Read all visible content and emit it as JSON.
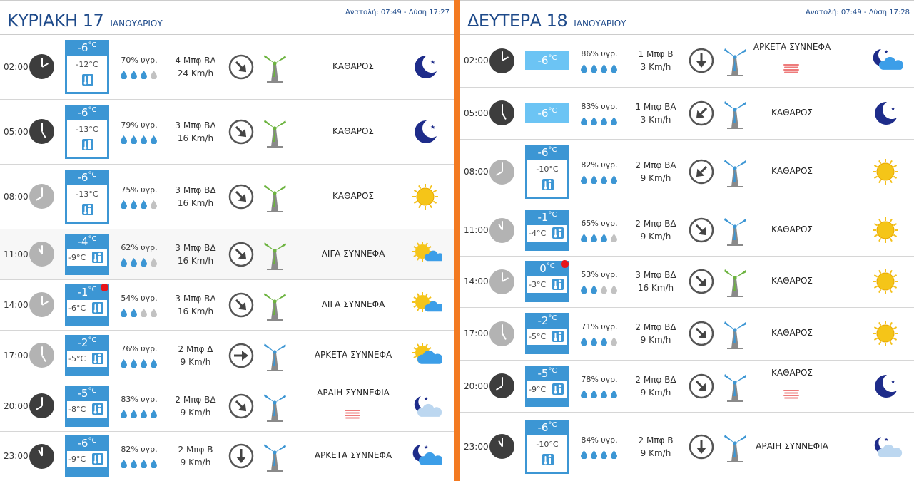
{
  "panels": [
    {
      "day_name": "ΚΥΡΙΑΚΗ 17",
      "month": "ΙΑΝΟΥΑΡΙΟΥ",
      "sun_info": "Ανατολή: 07:49 - Δύση 17:27",
      "rows": [
        {
          "time": "02:00",
          "clock": "night",
          "temp": "-6",
          "feels": "-12°C",
          "box": "full",
          "humidity": "70% υγρ.",
          "drops": [
            1,
            1,
            1,
            0
          ],
          "wind_force": "4 Μπφ ΒΔ",
          "wind_speed": "24 Km/h",
          "arrow": "down-right",
          "turbine": "green",
          "condition": "ΚΑΘΑΡΟΣ",
          "icon": "moon-icon",
          "haze": false,
          "hot": false,
          "shade": false
        },
        {
          "time": "05:00",
          "clock": "night",
          "temp": "-6",
          "feels": "-13°C",
          "box": "full",
          "humidity": "79% υγρ.",
          "drops": [
            1,
            1,
            1,
            1
          ],
          "wind_force": "3 Μπφ ΒΔ",
          "wind_speed": "16 Km/h",
          "arrow": "down-right",
          "turbine": "green",
          "condition": "ΚΑΘΑΡΟΣ",
          "icon": "moon-icon",
          "haze": false,
          "hot": false,
          "shade": false
        },
        {
          "time": "08:00",
          "clock": "day",
          "temp": "-6",
          "feels": "-13°C",
          "box": "full",
          "humidity": "75% υγρ.",
          "drops": [
            1,
            1,
            1,
            0
          ],
          "wind_force": "3 Μπφ ΒΔ",
          "wind_speed": "16 Km/h",
          "arrow": "down-right",
          "turbine": "green",
          "condition": "ΚΑΘΑΡΟΣ",
          "icon": "sun-icon",
          "haze": false,
          "hot": false,
          "shade": false
        },
        {
          "time": "11:00",
          "clock": "day",
          "temp": "-4",
          "feels": "-9°C",
          "box": "half",
          "humidity": "62% υγρ.",
          "drops": [
            1,
            1,
            1,
            0
          ],
          "wind_force": "3 Μπφ ΒΔ",
          "wind_speed": "16 Km/h",
          "arrow": "down-right",
          "turbine": "green",
          "condition": "ΛΙΓΑ ΣΥΝΝΕΦΑ",
          "icon": "sun-small-cloud-icon",
          "haze": false,
          "hot": false,
          "shade": true
        },
        {
          "time": "14:00",
          "clock": "day",
          "temp": "-1",
          "feels": "-6°C",
          "box": "half",
          "humidity": "54% υγρ.",
          "drops": [
            1,
            1,
            0,
            0
          ],
          "wind_force": "3 Μπφ ΒΔ",
          "wind_speed": "16 Km/h",
          "arrow": "down-right",
          "turbine": "green",
          "condition": "ΛΙΓΑ ΣΥΝΝΕΦΑ",
          "icon": "sun-small-cloud-icon",
          "haze": false,
          "hot": true,
          "shade": false
        },
        {
          "time": "17:00",
          "clock": "day",
          "temp": "-2",
          "feels": "-5°C",
          "box": "half",
          "humidity": "76% υγρ.",
          "drops": [
            1,
            1,
            1,
            1
          ],
          "wind_force": "2 Μπφ Δ",
          "wind_speed": "9 Km/h",
          "arrow": "right",
          "turbine": "blue",
          "condition": "ΑΡΚΕΤΑ ΣΥΝΝΕΦΑ",
          "icon": "sun-cloud-icon",
          "haze": false,
          "hot": false,
          "shade": false
        },
        {
          "time": "20:00",
          "clock": "night",
          "temp": "-5",
          "feels": "-8°C",
          "box": "half",
          "humidity": "83% υγρ.",
          "drops": [
            1,
            1,
            1,
            1
          ],
          "wind_force": "2 Μπφ ΒΔ",
          "wind_speed": "9 Km/h",
          "arrow": "down-right",
          "turbine": "blue",
          "condition": "ΑΡΑΙΗ ΣΥΝΝΕΦΙΑ",
          "icon": "moon-haze-icon",
          "haze": true,
          "hot": false,
          "shade": false
        },
        {
          "time": "23:00",
          "clock": "night",
          "temp": "-6",
          "feels": "-9°C",
          "box": "half",
          "humidity": "82% υγρ.",
          "drops": [
            1,
            1,
            1,
            1
          ],
          "wind_force": "2 Μπφ Β",
          "wind_speed": "9 Km/h",
          "arrow": "down",
          "turbine": "blue",
          "condition": "ΑΡΚΕΤΑ ΣΥΝΝΕΦΑ",
          "icon": "moon-cloud-icon",
          "haze": false,
          "hot": false,
          "shade": false
        }
      ]
    },
    {
      "day_name": "ΔΕΥΤΕΡΑ 18",
      "month": "ΙΑΝΟΥΑΡΙΟΥ",
      "sun_info": "Ανατολή: 07:49 - Δύση 17:28",
      "rows": [
        {
          "time": "02:00",
          "clock": "night",
          "temp": "-6",
          "feels": "",
          "box": "none",
          "humidity": "86% υγρ.",
          "drops": [
            1,
            1,
            1,
            1
          ],
          "wind_force": "1 Μπφ Β",
          "wind_speed": "3 Km/h",
          "arrow": "down",
          "turbine": "blue",
          "condition": "ΑΡΚΕΤΑ ΣΥΝΝΕΦΑ",
          "icon": "moon-cloud-icon",
          "haze": true,
          "hot": false,
          "shade": false
        },
        {
          "time": "05:00",
          "clock": "night",
          "temp": "-6",
          "feels": "",
          "box": "none",
          "humidity": "83% υγρ.",
          "drops": [
            1,
            1,
            1,
            1
          ],
          "wind_force": "1 Μπφ ΒΑ",
          "wind_speed": "3 Km/h",
          "arrow": "down-left",
          "turbine": "blue",
          "condition": "ΚΑΘΑΡΟΣ",
          "icon": "moon-icon",
          "haze": false,
          "hot": false,
          "shade": false
        },
        {
          "time": "08:00",
          "clock": "day",
          "temp": "-6",
          "feels": "-10°C",
          "box": "full",
          "humidity": "82% υγρ.",
          "drops": [
            1,
            1,
            1,
            1
          ],
          "wind_force": "2 Μπφ ΒΑ",
          "wind_speed": "9 Km/h",
          "arrow": "down-left",
          "turbine": "blue",
          "condition": "ΚΑΘΑΡΟΣ",
          "icon": "sun-icon",
          "haze": false,
          "hot": false,
          "shade": false
        },
        {
          "time": "11:00",
          "clock": "day",
          "temp": "-1",
          "feels": "-4°C",
          "box": "half",
          "humidity": "65% υγρ.",
          "drops": [
            1,
            1,
            1,
            0
          ],
          "wind_force": "2 Μπφ ΒΔ",
          "wind_speed": "9 Km/h",
          "arrow": "down-right",
          "turbine": "blue",
          "condition": "ΚΑΘΑΡΟΣ",
          "icon": "sun-icon",
          "haze": false,
          "hot": false,
          "shade": false
        },
        {
          "time": "14:00",
          "clock": "day",
          "temp": "0",
          "feels": "-3°C",
          "box": "half",
          "humidity": "53% υγρ.",
          "drops": [
            1,
            1,
            0,
            0
          ],
          "wind_force": "3 Μπφ ΒΔ",
          "wind_speed": "16 Km/h",
          "arrow": "down-right",
          "turbine": "green",
          "condition": "ΚΑΘΑΡΟΣ",
          "icon": "sun-icon",
          "haze": false,
          "hot": true,
          "shade": false
        },
        {
          "time": "17:00",
          "clock": "day",
          "temp": "-2",
          "feels": "-5°C",
          "box": "half",
          "humidity": "71% υγρ.",
          "drops": [
            1,
            1,
            1,
            0
          ],
          "wind_force": "2 Μπφ ΒΔ",
          "wind_speed": "9 Km/h",
          "arrow": "down-right",
          "turbine": "blue",
          "condition": "ΚΑΘΑΡΟΣ",
          "icon": "sun-icon",
          "haze": false,
          "hot": false,
          "shade": false
        },
        {
          "time": "20:00",
          "clock": "night",
          "temp": "-5",
          "feels": "-9°C",
          "box": "half",
          "humidity": "78% υγρ.",
          "drops": [
            1,
            1,
            1,
            1
          ],
          "wind_force": "2 Μπφ ΒΔ",
          "wind_speed": "9 Km/h",
          "arrow": "down-right",
          "turbine": "blue",
          "condition": "ΚΑΘΑΡΟΣ",
          "icon": "moon-icon",
          "haze": true,
          "hot": false,
          "shade": false
        },
        {
          "time": "23:00",
          "clock": "night",
          "temp": "-6",
          "feels": "-10°C",
          "box": "full",
          "humidity": "84% υγρ.",
          "drops": [
            1,
            1,
            1,
            1
          ],
          "wind_force": "2 Μπφ Β",
          "wind_speed": "9 Km/h",
          "arrow": "down",
          "turbine": "blue",
          "condition": "ΑΡΑΙΗ ΣΥΝΝΕΦΙΑ",
          "icon": "moon-haze-icon",
          "haze": false,
          "hot": false,
          "shade": false
        }
      ]
    }
  ]
}
